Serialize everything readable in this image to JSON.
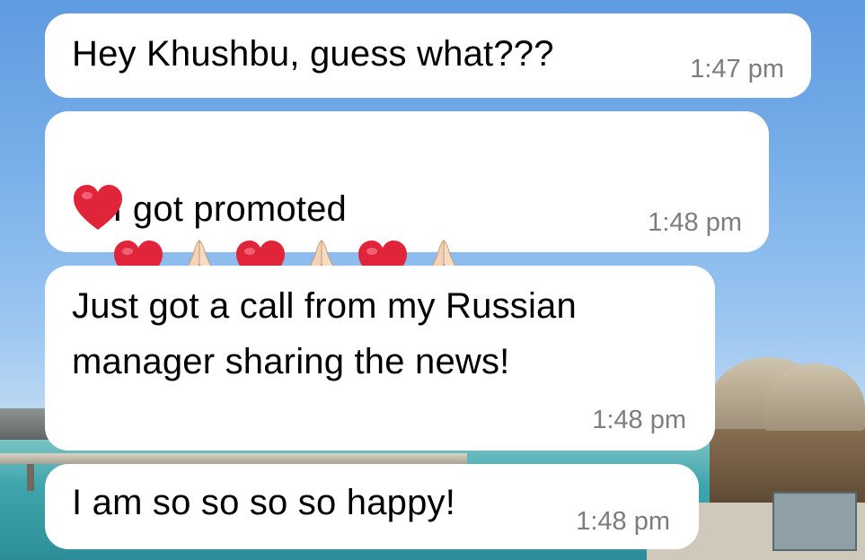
{
  "chat": {
    "messages": [
      {
        "text": "Hey Khushbu, guess what???",
        "time": "1:47 pm"
      },
      {
        "text": "I got promoted",
        "emoji": [
          "heart",
          "folded-hands",
          "heart",
          "folded-hands",
          "heart",
          "folded-hands",
          "heart"
        ],
        "time": "1:48 pm"
      },
      {
        "text_lines": [
          "Just got a call from my Russian",
          "manager sharing the news!"
        ],
        "time": "1:48 pm"
      },
      {
        "text": "I am so so so so happy!",
        "time": "1:48 pm"
      }
    ]
  },
  "colors": {
    "bubble": "#ffffff",
    "timestamp": "#7d7d7d",
    "heart": "#e0243a",
    "sky": "#79afe9"
  }
}
